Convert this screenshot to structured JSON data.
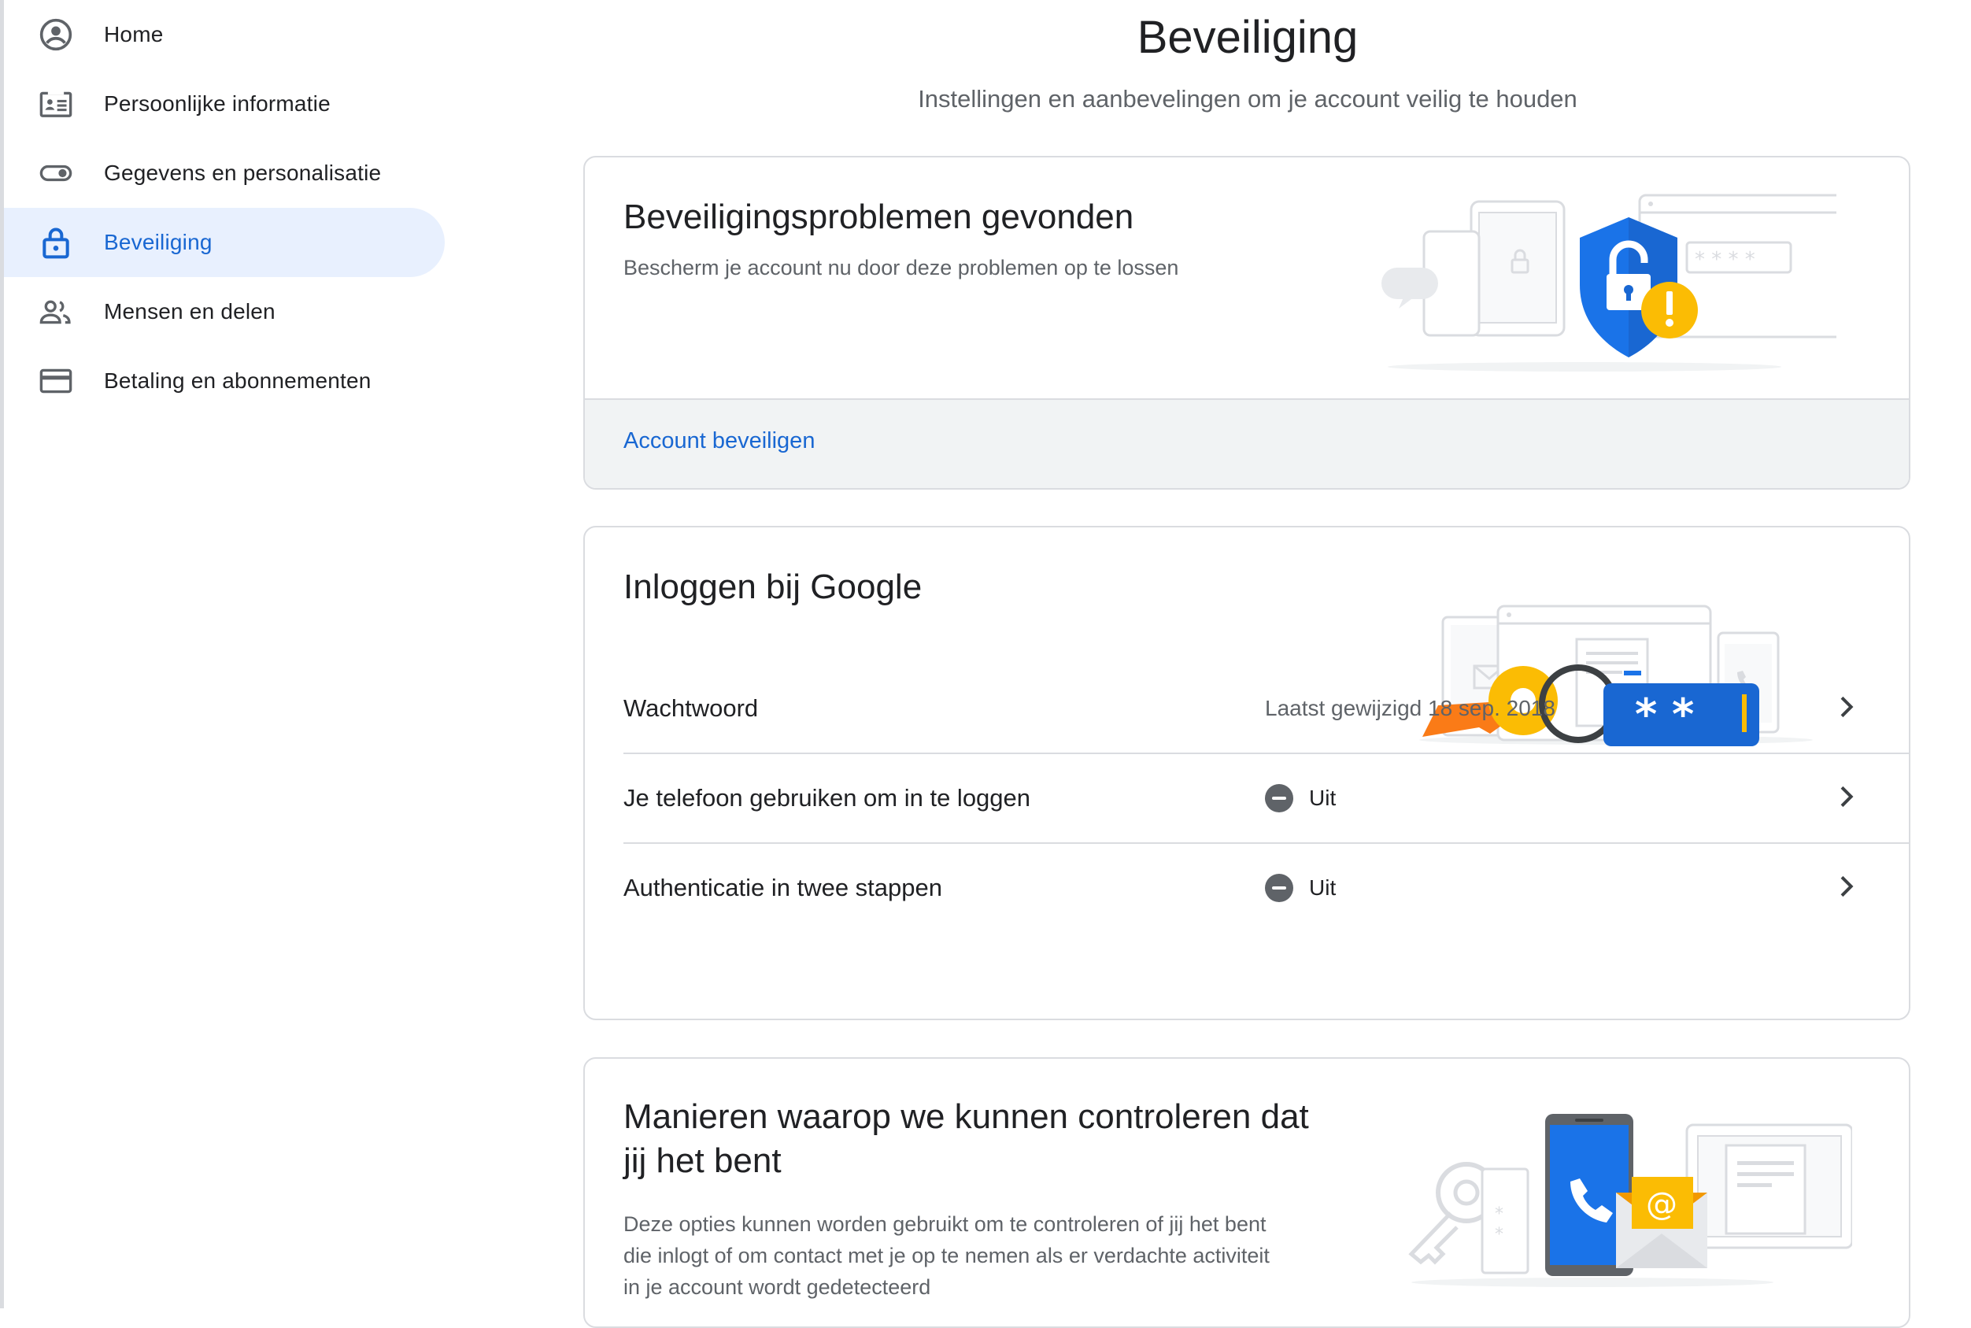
{
  "sidebar": {
    "items": [
      {
        "label": "Home",
        "icon": "account-circle-icon"
      },
      {
        "label": "Persoonlijke informatie",
        "icon": "id-card-icon"
      },
      {
        "label": "Gegevens en personalisatie",
        "icon": "toggle-icon"
      },
      {
        "label": "Beveiliging",
        "icon": "lock-icon",
        "active": true
      },
      {
        "label": "Mensen en delen",
        "icon": "people-icon"
      },
      {
        "label": "Betaling en abonnementen",
        "icon": "credit-card-icon"
      }
    ]
  },
  "header": {
    "title": "Beveiliging",
    "subtitle": "Instellingen en aanbevelingen om je account veilig te houden"
  },
  "issues_card": {
    "title": "Beveiligingsproblemen gevonden",
    "description": "Bescherm je account nu door deze problemen op te lossen",
    "action_label": "Account beveiligen",
    "illustration": "shield-warning-illustration"
  },
  "signin_card": {
    "title": "Inloggen bij Google",
    "illustration": "key-password-illustration",
    "rows": [
      {
        "label": "Wachtwoord",
        "value": "Laatst gewijzigd 18 sep. 2018"
      },
      {
        "label": "Je telefoon gebruiken om in te loggen",
        "status": "Uit"
      },
      {
        "label": "Authenticatie in twee stappen",
        "status": "Uit"
      }
    ]
  },
  "verify_card": {
    "title_line1": "Manieren waarop we kunnen controleren dat",
    "title_line2": "jij het bent",
    "description_line1": "Deze opties kunnen worden gebruikt om te controleren of jij het bent",
    "description_line2": "die inlogt of om contact met je op te nemen als er verdachte activiteit",
    "description_line3": "in je account wordt gedetecteerd",
    "illustration": "phone-email-illustration"
  },
  "colors": {
    "accent": "#1967d2",
    "active_bg": "#e8f0fe",
    "warning": "#fbbc04",
    "shield": "#1a73e8"
  }
}
